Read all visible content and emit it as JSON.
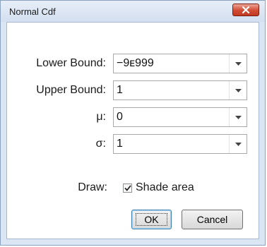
{
  "window": {
    "title": "Normal Cdf"
  },
  "fields": [
    {
      "label": "Lower Bound:",
      "value": "−9ᴇ999"
    },
    {
      "label": "Upper Bound:",
      "value": "1"
    },
    {
      "label": "μ:",
      "value": "0"
    },
    {
      "label": "σ:",
      "value": "1"
    }
  ],
  "draw": {
    "label": "Draw:",
    "checkbox_label": "Shade area",
    "checked": true
  },
  "buttons": {
    "ok": "OK",
    "cancel": "Cancel"
  },
  "icons": {
    "close": "close-icon",
    "dropdown": "chevron-down-icon",
    "check": "check-icon"
  },
  "colors": {
    "close_button": "#d14b33",
    "frame": "#dbe6f4"
  }
}
